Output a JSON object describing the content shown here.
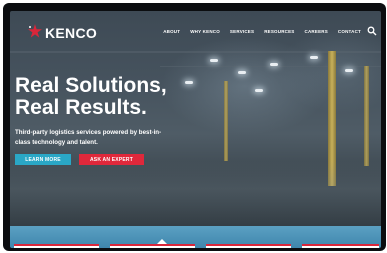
{
  "brand": {
    "name": "KENCO"
  },
  "nav": {
    "items": [
      "ABOUT",
      "WHY KENCO",
      "SERVICES",
      "RESOURCES",
      "CAREERS",
      "CONTACT"
    ]
  },
  "hero": {
    "headline_1": "Real Solutions,",
    "headline_2": "Real Results.",
    "subline": "Third-party logistics services powered by best-in-class technology and talent.",
    "learn_more": "LEARN MORE",
    "ask_expert": "ASK AN EXPERT"
  },
  "colors": {
    "cta_primary": "#2aa7c6",
    "cta_secondary": "#e0283b",
    "brand_red": "#d9263a",
    "band": "#4a92b8"
  },
  "icons": [
    "kenco-star-logo-icon",
    "search-icon"
  ]
}
